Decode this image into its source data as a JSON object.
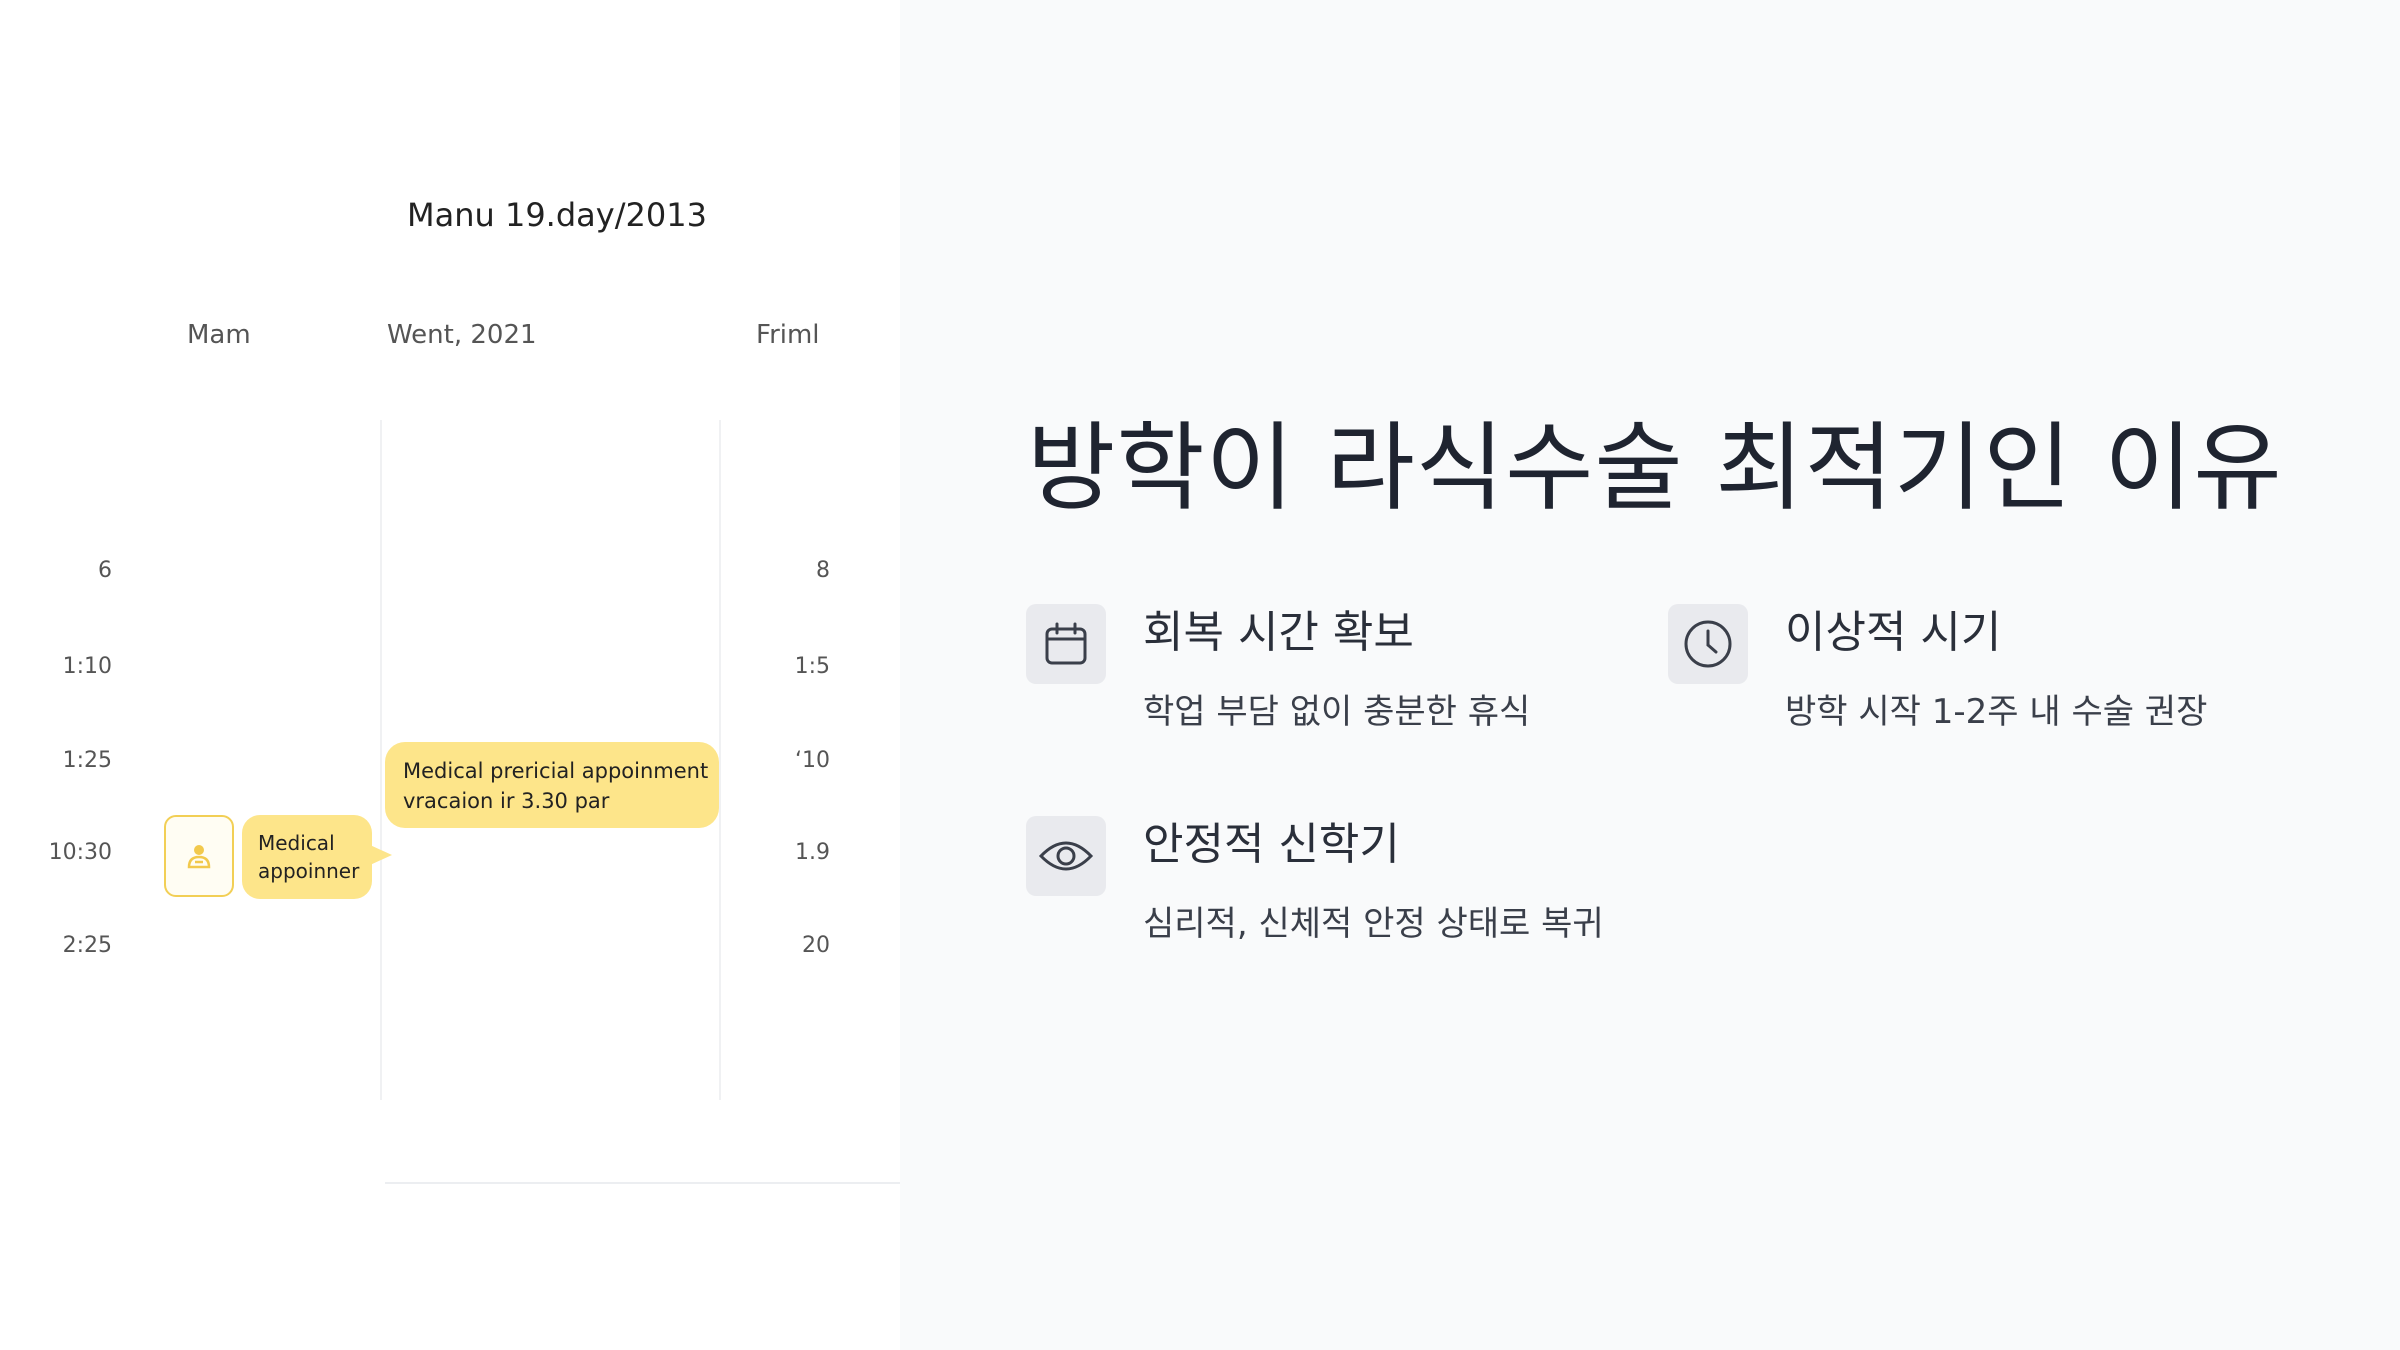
{
  "calendar": {
    "title": "Manu 19.day/2013",
    "days": [
      "Mam",
      "Went, 2021",
      "Friml"
    ],
    "times_left": [
      "6",
      "1:10",
      "1:25",
      "10:30",
      "2:25"
    ],
    "times_right": [
      "8",
      "1:5",
      "‘10",
      "1.9",
      "20"
    ],
    "event_large": {
      "line1": "Medical prericial appoinment",
      "line2": "vracaion ir 3.30 par"
    },
    "event_small": {
      "line1": "Medical",
      "line2": "appoinner"
    },
    "event_icon": "doctor-icon",
    "accent_color": "#fde58a"
  },
  "slide": {
    "title": "방학이 라식수술 최적기인 이유",
    "features": [
      {
        "icon": "calendar-icon",
        "title": "회복 시간 확보",
        "desc": "학업 부담 없이 충분한 휴식"
      },
      {
        "icon": "clock-icon",
        "title": "이상적 시기",
        "desc": "방학 시작 1-2주 내 수술 권장"
      },
      {
        "icon": "eye-icon",
        "title": "안정적 신학기",
        "desc": "심리적, 신체적 안정 상태로 복귀"
      }
    ]
  }
}
